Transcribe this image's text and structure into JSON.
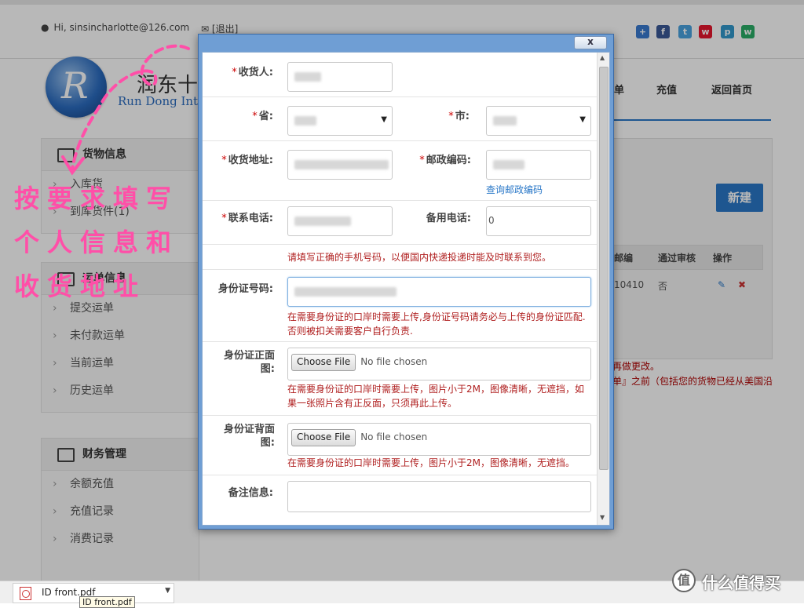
{
  "topbar": {
    "greeting": "Hi, sinsincharlotte@126.com",
    "logout": "[退出]",
    "social_icons": [
      "share-icon",
      "facebook-icon",
      "twitter-icon",
      "weibo-icon",
      "pinterest-icon",
      "wechat-icon"
    ]
  },
  "logo": {
    "letter": "R",
    "cn": "润东十",
    "en": "Run Dong Inte"
  },
  "nav": {
    "item1": "单",
    "item2": "充值",
    "item3": "返回首页"
  },
  "sidebar": {
    "goods": {
      "title": "货物信息",
      "items": [
        "入库货",
        "到库货件(1)"
      ]
    },
    "waybill": {
      "title": "运单信息",
      "items": [
        "提交运单",
        "未付款运单",
        "当前运单",
        "历史运单"
      ]
    },
    "finance": {
      "title": "财务管理",
      "items": [
        "余额充值",
        "充值记录",
        "消费记录"
      ]
    }
  },
  "bg_content": {
    "new_button": "新建",
    "col1": "邮编",
    "col2": "通过审核",
    "col3": "操作",
    "row_value1": "10410",
    "row_value2": "否",
    "note1": "再做更改。",
    "note2": "单』之前（包括您的货物已经从美国沿"
  },
  "annotation": {
    "line1": "按要求填写",
    "line2": "个人信息和",
    "line3": "收货地址"
  },
  "modal": {
    "close": "x",
    "recipient": {
      "label": "收货人:"
    },
    "province": {
      "label": "省:"
    },
    "city": {
      "label": "市:"
    },
    "address": {
      "label": "收货地址:"
    },
    "postcode": {
      "label": "邮政编码:",
      "link": "查询邮政编码"
    },
    "phone": {
      "label": "联系电话:"
    },
    "alt_phone": {
      "label": "备用电话:",
      "value": "0"
    },
    "phone_hint": "请填写正确的手机号码，以便国内快递投递时能及时联系到您。",
    "id_number": {
      "label": "身份证号码:",
      "hint_line1": "在需要身份证的口岸时需要上传,身份证号码请务必与上传的身份证匹配.",
      "hint_line2": "否则被扣关需要客户自行负责."
    },
    "id_front": {
      "label_line1": "身份证正面",
      "label_line2": "图:",
      "button": "Choose File",
      "status": "No file chosen",
      "hint_line1": "在需要身份证的口岸时需要上传，图片小于2M，图像清晰，无遮挡，如",
      "hint_line2": "果一张照片含有正反面，只须再此上传。"
    },
    "id_back": {
      "label_line1": "身份证背面",
      "label_line2": "图:",
      "button": "Choose File",
      "status": "No file chosen",
      "hint": "在需要身份证的口岸时需要上传，图片小于2M，图像清晰，无遮挡。"
    },
    "remarks": {
      "label": "备注信息:"
    }
  },
  "taskbar": {
    "download_name": "ID front.pdf",
    "tooltip": "ID front.pdf"
  },
  "watermark": {
    "icon": "值",
    "text": "什么值得买"
  },
  "colors": {
    "annotation": "#ff4fa8",
    "accent": "#2a78c8",
    "required": "#cc0000",
    "hint": "#b02020"
  }
}
